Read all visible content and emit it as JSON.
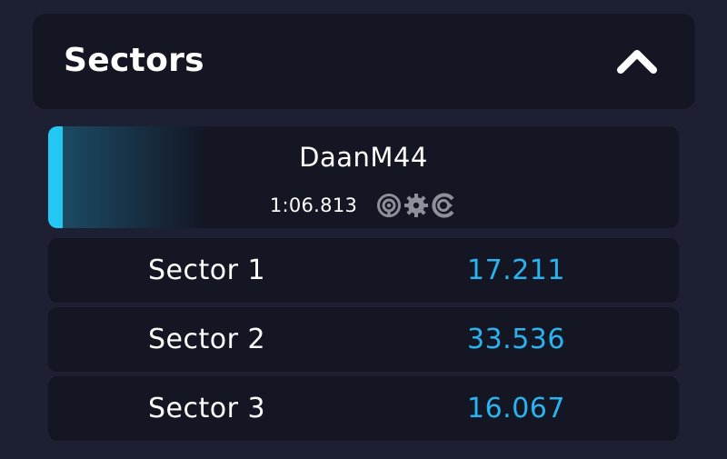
{
  "header": {
    "title": "Sectors",
    "collapse_icon": "chevron-up-icon"
  },
  "driver": {
    "name": "DaanM44",
    "lap_time": "1:06.813",
    "assist_icons": [
      "steering-wheel-icon",
      "gear-icon",
      "abs-icon"
    ],
    "accent_color": "#23c8f3"
  },
  "sectors": [
    {
      "label": "Sector 1",
      "time": "17.211"
    },
    {
      "label": "Sector 2",
      "time": "33.536"
    },
    {
      "label": "Sector 3",
      "time": "16.067"
    }
  ],
  "colors": {
    "background": "#1d2032",
    "panel": "#141623",
    "time": "#2ab4ef"
  }
}
